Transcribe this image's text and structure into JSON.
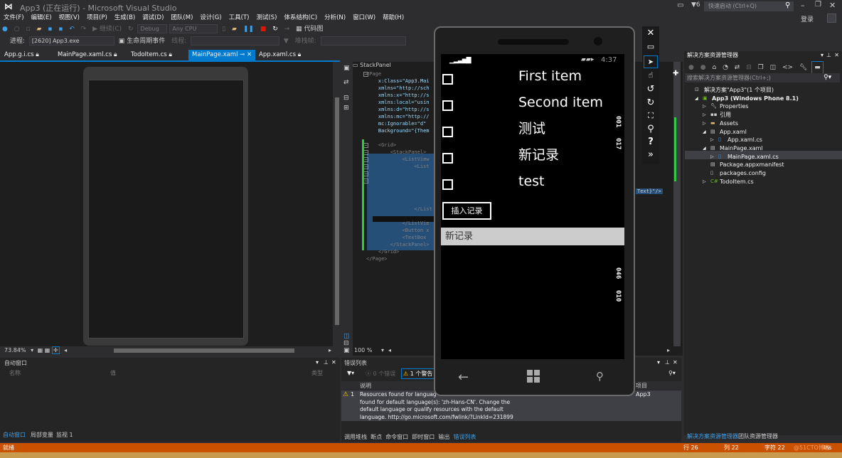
{
  "window": {
    "title": "App3 (正在运行) - Microsoft Visual Studio",
    "notifications_count": "6",
    "quick_launch_placeholder": "快速启动 (Ctrl+Q)",
    "login": "登录"
  },
  "menu": [
    "文件(F)",
    "编辑(E)",
    "视图(V)",
    "项目(P)",
    "生成(B)",
    "调试(D)",
    "团队(M)",
    "设计(G)",
    "工具(T)",
    "测试(S)",
    "体系结构(C)",
    "分析(N)",
    "窗口(W)",
    "帮助(H)"
  ],
  "toolbar": {
    "continue": "继续(C)",
    "config": "Debug",
    "platform": "Any CPU",
    "code_map": "代码图",
    "process_label": "进程:",
    "process_value": "[2620] App3.exe",
    "lifecycle": "生命周期事件",
    "thread_label": "线程:",
    "stackframe_label": "堆栈帧:"
  },
  "tabs": [
    {
      "label": "App.g.i.cs",
      "active": false
    },
    {
      "label": "MainPage.xaml.cs",
      "active": false
    },
    {
      "label": "TodoItem.cs",
      "active": false
    },
    {
      "label": "MainPage.xaml",
      "active": true
    },
    {
      "label": "App.xaml.cs",
      "active": false
    }
  ],
  "designer": {
    "zoom": "73.84%"
  },
  "xaml": {
    "breadcrumb": "StackPanel",
    "zoom": "100 %",
    "lines": [
      "<Page",
      "    x:Class=\"App3.Mai",
      "    xmlns=\"http://sch",
      "    xmlns:x=\"http://s",
      "    xmlns:local=\"usin",
      "    xmlns:d=\"http://s",
      "    xmlns:mc=\"http://",
      "    mc:Ignorable=\"d\"",
      "    Background=\"{Them",
      "",
      "    <Grid>",
      "        <StackPanel>",
      "            <ListView",
      "                <List",
      "",
      "",
      "",
      "",
      "",
      "                </List",
      "",
      "            </ListVie",
      "            <Button x",
      "            <TextBox",
      "        </StackPanel>",
      "    </Grid>",
      "</Page>"
    ],
    "right_fragment": "Text}\"/>"
  },
  "emulator": {
    "time": "4:37",
    "items": [
      "First item",
      "Second item",
      "测试",
      "新记录",
      "test"
    ],
    "insert_button": "插入记录",
    "textbox_value": "新记录",
    "frame_counters": [
      "001",
      "017",
      "046",
      "010"
    ],
    "tools": [
      "close",
      "minimize",
      "single-point",
      "mouse",
      "rotate-left",
      "rotate-right",
      "fit-to-screen",
      "zoom",
      "help",
      "additional-tools"
    ]
  },
  "solution_explorer": {
    "title": "解决方案资源管理器",
    "search_placeholder": "搜索解决方案资源管理器(Ctrl+;)",
    "tree": [
      {
        "label": "解决方案\"App3\"(1 个项目)",
        "level": 0,
        "icon": "solution"
      },
      {
        "label": "App3 (Windows Phone 8.1)",
        "level": 1,
        "icon": "csproj",
        "bold": true
      },
      {
        "label": "Properties",
        "level": 2,
        "icon": "wrench"
      },
      {
        "label": "引用",
        "level": 2,
        "icon": "references"
      },
      {
        "label": "Assets",
        "level": 2,
        "icon": "folder"
      },
      {
        "label": "App.xaml",
        "level": 2,
        "icon": "xaml"
      },
      {
        "label": "App.xaml.cs",
        "level": 3,
        "icon": "cs-file"
      },
      {
        "label": "MainPage.xaml",
        "level": 2,
        "icon": "xaml"
      },
      {
        "label": "MainPage.xaml.cs",
        "level": 3,
        "icon": "cs-file",
        "selected": true
      },
      {
        "label": "Package.appxmanifest",
        "level": 2,
        "icon": "manifest"
      },
      {
        "label": "packages.config",
        "level": 2,
        "icon": "config"
      },
      {
        "label": "TodoItem.cs",
        "level": 2,
        "icon": "cs-class"
      }
    ],
    "bottom_tabs": [
      "解决方案资源管理器",
      "团队资源管理器"
    ]
  },
  "autos": {
    "title": "自动窗口",
    "columns": [
      "名称",
      "值",
      "类型"
    ],
    "bottom_tabs": [
      "自动窗口",
      "局部变量",
      "监视 1"
    ]
  },
  "error_list": {
    "title": "错误列表",
    "errors_filter": "0 个错误",
    "warnings_filter": "1 个警告",
    "columns": [
      "说明",
      "项目"
    ],
    "rows": [
      {
        "index": "1",
        "type": "warning",
        "description": "Resources found for language(s) ... found for default language(s): 'zh-Hans-CN'. Change the default language or qualify resources with the default language. http://go.microsoft.com/fwlink/?LinkId=231899",
        "line1": "Resources found for languag",
        "line2": "found for default language(s): 'zh-Hans-CN'. Change the",
        "line3": "default language or qualify resources with the default",
        "line4": "language. http://go.microsoft.com/fwlink/?LinkId=231899",
        "project": "App3"
      }
    ],
    "bottom_tabs": [
      "调用堆栈",
      "断点",
      "命令窗口",
      "即时窗口",
      "输出",
      "错误列表"
    ]
  },
  "status": {
    "ready": "就绪",
    "line": "行 26",
    "col": "列 22",
    "char": "字符 22",
    "mode": "Ins",
    "watermark": "@51CTO博客"
  },
  "colors": {
    "accent": "#007acc",
    "status_bar": "#ca5100",
    "selection": "#264f78",
    "change_marker": "#2ecc40"
  }
}
